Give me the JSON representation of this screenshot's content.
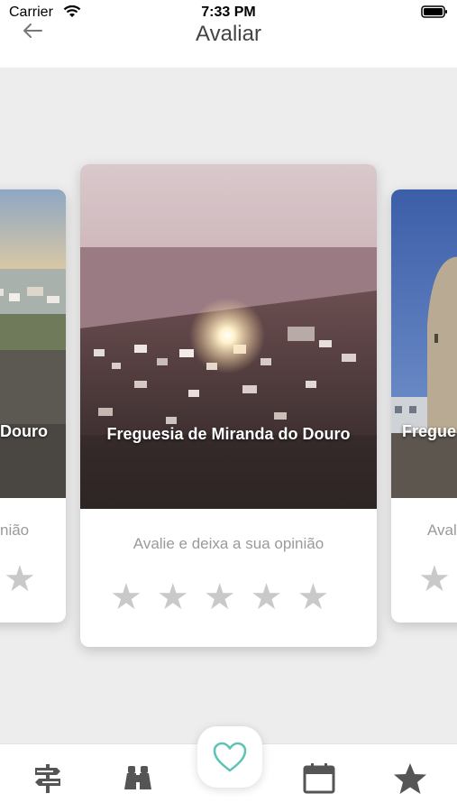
{
  "status_bar": {
    "carrier": "Carrier",
    "time": "7:33 PM"
  },
  "header": {
    "title": "Avaliar"
  },
  "cards": [
    {
      "title": "Douro",
      "subtitle": "nião"
    },
    {
      "title": "Freguesia de Miranda do Douro",
      "subtitle": "Avalie e deixa a sua opinião"
    },
    {
      "title": "Fregue",
      "subtitle": "Aval"
    }
  ],
  "tabs": [
    {
      "icon": "signpost-icon"
    },
    {
      "icon": "binoculars-icon"
    },
    {
      "icon": "heart-icon"
    },
    {
      "icon": "calendar-icon"
    },
    {
      "icon": "star-icon"
    }
  ],
  "colors": {
    "accent": "#5fc4b6",
    "icon_gray": "#555555",
    "star_gray": "#c9c9c9"
  }
}
